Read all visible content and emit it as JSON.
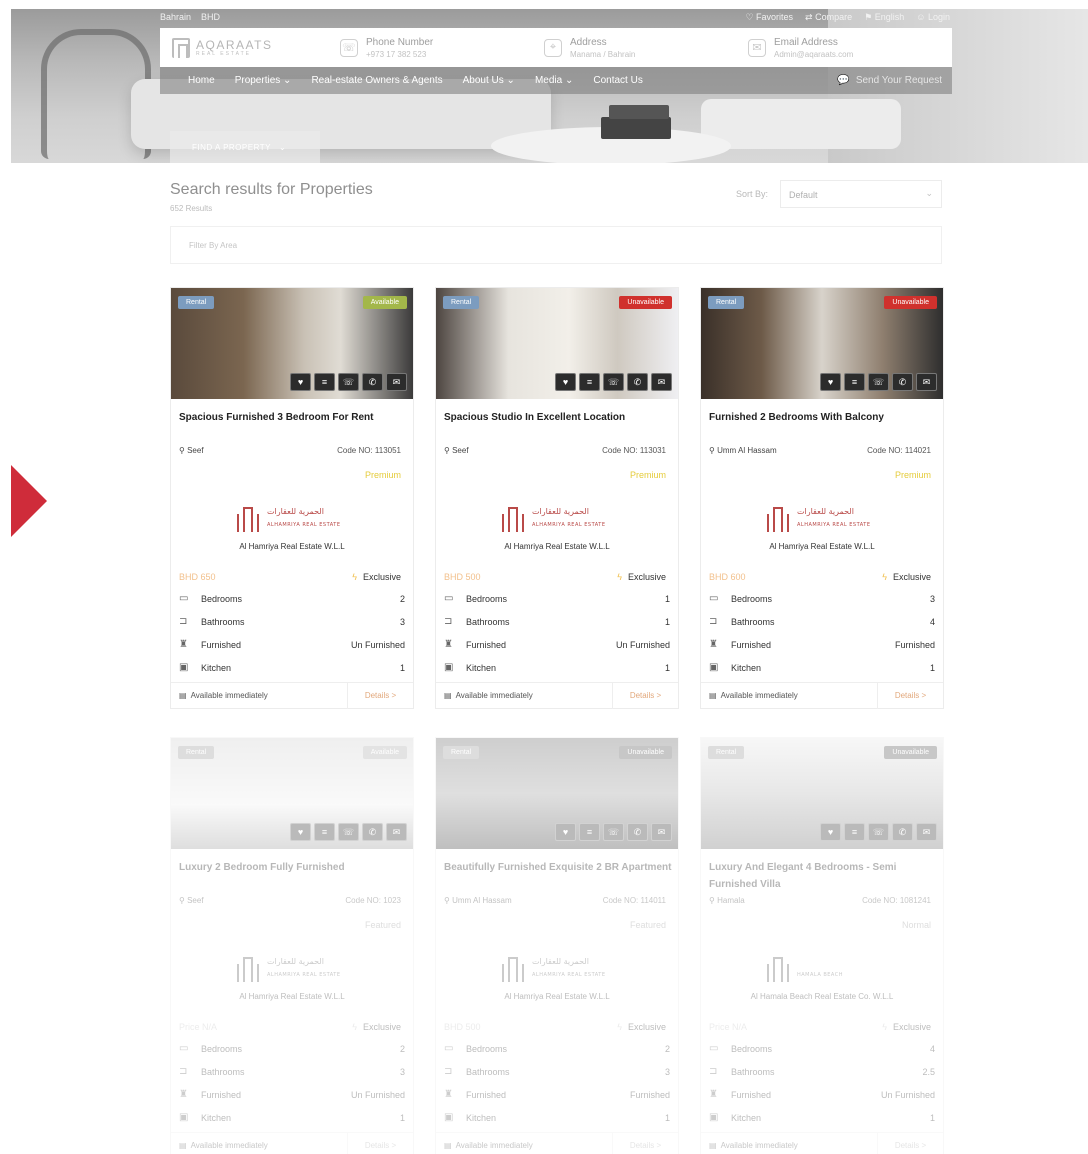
{
  "topbar": {
    "left": [
      "Bahrain",
      "BHD"
    ],
    "right": [
      "Favorites",
      "Compare",
      "English",
      "Login"
    ]
  },
  "brand": {
    "name": "AQARAATS",
    "sub": "REAL ESTATE"
  },
  "contact": {
    "phone_label": "Phone Number",
    "phone_value": "+973 17 382 523",
    "address_label": "Address",
    "address_value": "Manama / Bahrain",
    "email_label": "Email Address",
    "email_value": "Admin@aqaraats.com"
  },
  "nav": {
    "items": [
      "Home",
      "Properties",
      "Real-estate Owners & Agents",
      "About Us",
      "Media",
      "Contact Us"
    ],
    "request": "Send Your Request"
  },
  "find_button": "FIND A PROPERTY",
  "search": {
    "title": "Search results for Properties",
    "count": "652 Results",
    "sort_label": "Sort By:",
    "sort_value": "Default",
    "filter_placeholder": "Filter By Area"
  },
  "labels": {
    "bedrooms": "Bedrooms",
    "bathrooms": "Bathrooms",
    "furnished": "Furnished",
    "kitchen": "Kitchen",
    "exclusive": "Exclusive",
    "available": "Available immediately",
    "details": "Details >"
  },
  "colors": {
    "available": "#a3b74a",
    "unavailable": "#d0312d",
    "rental": "#7c9cbf",
    "price": "#f2c08c",
    "premium": "#e5cc3c",
    "details": "#e2a87c",
    "arrow": "#cf2c3a"
  },
  "cards": [
    {
      "tag": "Rental",
      "status": "Available",
      "title": "Spacious Furnished 3 Bedroom For Rent",
      "location": "Seef",
      "code": "Code NO: 113051",
      "tier": "Premium",
      "agency_ar": "الحمرية للعقارات",
      "agency_en": "ALHAMRIYA REAL ESTATE",
      "agency": "Al Hamriya Real Estate W.L.L",
      "price": "BHD 650",
      "bedrooms": "2",
      "bathrooms": "3",
      "furnished": "Un Furnished",
      "kitchen": "1"
    },
    {
      "tag": "Rental",
      "status": "Unavailable",
      "title": "Spacious Studio In Excellent Location",
      "location": "Seef",
      "code": "Code NO: 113031",
      "tier": "Premium",
      "agency_ar": "الحمرية للعقارات",
      "agency_en": "ALHAMRIYA REAL ESTATE",
      "agency": "Al Hamriya Real Estate W.L.L",
      "price": "BHD 500",
      "bedrooms": "1",
      "bathrooms": "1",
      "furnished": "Un Furnished",
      "kitchen": "1"
    },
    {
      "tag": "Rental",
      "status": "Unavailable",
      "title": "Furnished 2 Bedrooms With Balcony",
      "location": "Umm Al Hassam",
      "code": "Code NO: 114021",
      "tier": "Premium",
      "agency_ar": "الحمرية للعقارات",
      "agency_en": "ALHAMRIYA REAL ESTATE",
      "agency": "Al Hamriya Real Estate W.L.L",
      "price": "BHD 600",
      "bedrooms": "3",
      "bathrooms": "4",
      "furnished": "Furnished",
      "kitchen": "1"
    },
    {
      "tag": "Rental",
      "status": "Available",
      "title": "Luxury 2 Bedroom Fully Furnished",
      "location": "Seef",
      "code": "Code NO: 1023",
      "tier": "Featured",
      "agency_ar": "الحمرية للعقارات",
      "agency_en": "ALHAMRIYA REAL ESTATE",
      "agency": "Al Hamriya Real Estate W.L.L",
      "price": "Price N/A",
      "bedrooms": "2",
      "bathrooms": "3",
      "furnished": "Un Furnished",
      "kitchen": "1"
    },
    {
      "tag": "Rental",
      "status": "Unavailable",
      "title": "Beautifully Furnished Exquisite 2 BR Apartment",
      "location": "Umm Al Hassam",
      "code": "Code NO: 114011",
      "tier": "Featured",
      "agency_ar": "الحمرية للعقارات",
      "agency_en": "ALHAMRIYA REAL ESTATE",
      "agency": "Al Hamriya Real Estate W.L.L",
      "price": "BHD 500",
      "bedrooms": "2",
      "bathrooms": "3",
      "furnished": "Furnished",
      "kitchen": "1"
    },
    {
      "tag": "Rental",
      "status": "Unavailable",
      "title": "Luxury And Elegant 4 Bedrooms - Semi Furnished Villa",
      "location": "Hamala",
      "code": "Code NO: 1081241",
      "tier": "Normal",
      "agency_ar": "",
      "agency_en": "HAMALA BEACH",
      "agency": "Al Hamala Beach Real Estate Co. W.L.L",
      "price": "Price N/A",
      "bedrooms": "4",
      "bathrooms": "2.5",
      "furnished": "Un Furnished",
      "kitchen": "1"
    }
  ]
}
